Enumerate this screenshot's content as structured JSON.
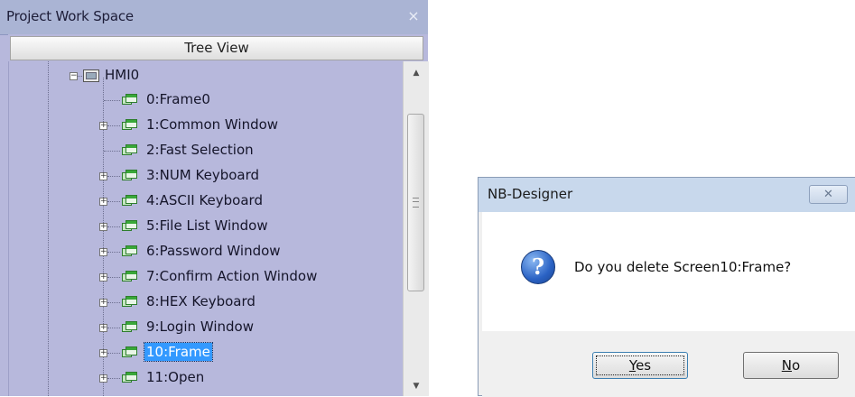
{
  "workspace": {
    "title": "Project Work Space",
    "close_glyph": "×",
    "tab_label": "Tree View"
  },
  "tree": {
    "root": {
      "label": "HMI0",
      "expander": "−",
      "icon": "hmi-device-icon"
    },
    "items": [
      {
        "label": "0:Frame0",
        "expandable": false
      },
      {
        "label": "1:Common Window",
        "expandable": true
      },
      {
        "label": "2:Fast Selection",
        "expandable": false
      },
      {
        "label": "3:NUM Keyboard",
        "expandable": true
      },
      {
        "label": "4:ASCII Keyboard",
        "expandable": true
      },
      {
        "label": "5:File List Window",
        "expandable": true
      },
      {
        "label": "6:Password Window",
        "expandable": true
      },
      {
        "label": "7:Confirm Action Window",
        "expandable": true
      },
      {
        "label": "8:HEX Keyboard",
        "expandable": true
      },
      {
        "label": "9:Login Window",
        "expandable": true
      },
      {
        "label": "10:Frame",
        "expandable": true,
        "selected": true
      },
      {
        "label": "11:Open",
        "expandable": true
      }
    ],
    "expander_glyph": "+"
  },
  "scrollbar": {
    "up_glyph": "▲",
    "down_glyph": "▼"
  },
  "dialog": {
    "title": "NB-Designer",
    "close_glyph": "✕",
    "icon_glyph": "?",
    "message": "Do you delete Screen10:Frame?",
    "yes": {
      "accel": "Y",
      "rest": "es"
    },
    "no": {
      "accel": "N",
      "rest": "o"
    }
  },
  "colors": {
    "tree_background": "#b7b8dc",
    "selection": "#3399ff",
    "window_icon": "#39a839"
  }
}
